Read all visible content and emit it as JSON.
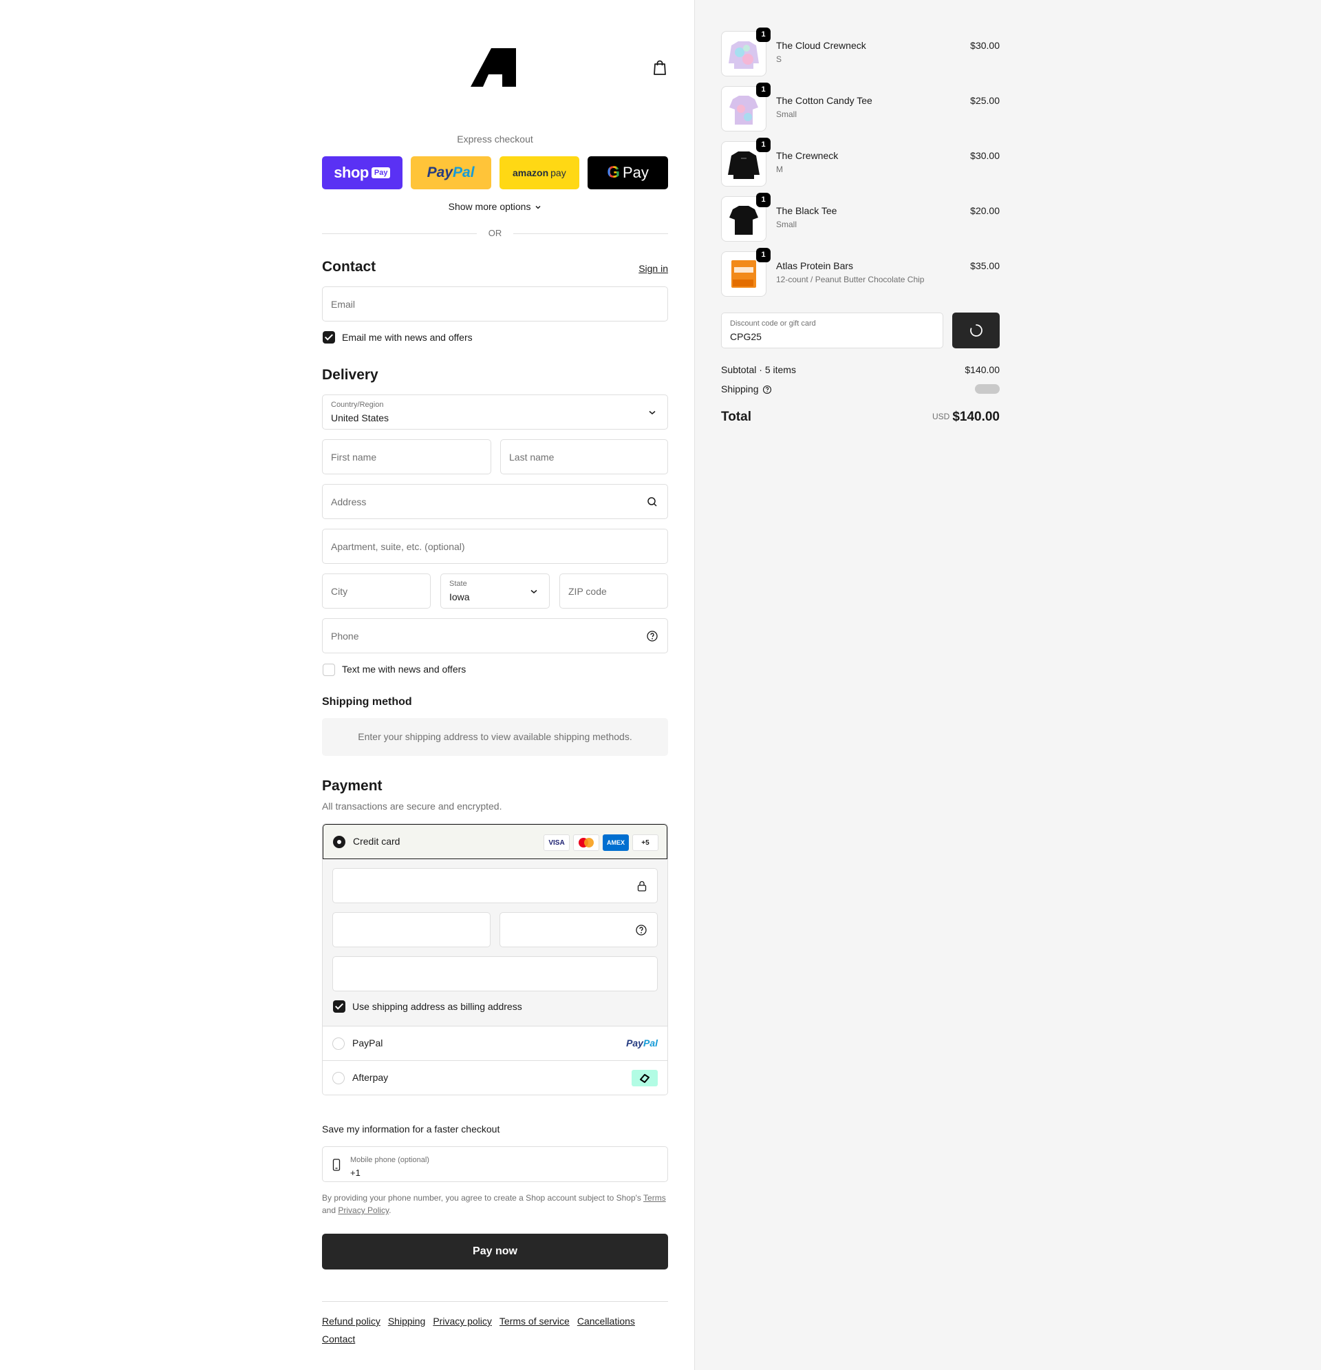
{
  "express": {
    "title": "Express checkout",
    "shoppay_word": "shop",
    "shoppay_pay": "Pay",
    "paypal_a": "Pay",
    "paypal_b": "Pal",
    "amazon_a": "amazon",
    "amazon_b": "pay",
    "gpay_g": "G",
    "gpay_pay": "Pay",
    "show_more": "Show more options",
    "or": "OR"
  },
  "contact": {
    "heading": "Contact",
    "sign_in": "Sign in",
    "email_placeholder": "Email",
    "news_label": "Email me with news and offers",
    "news_checked": true
  },
  "delivery": {
    "heading": "Delivery",
    "country_label": "Country/Region",
    "country_value": "United States",
    "first_name": "First name",
    "last_name": "Last name",
    "address": "Address",
    "apartment": "Apartment, suite, etc. (optional)",
    "city": "City",
    "state_label": "State",
    "state_value": "Iowa",
    "zip": "ZIP code",
    "phone": "Phone",
    "text_label": "Text me with news and offers",
    "text_checked": false
  },
  "shipping_method": {
    "heading": "Shipping method",
    "note": "Enter your shipping address to view available shipping methods."
  },
  "payment": {
    "heading": "Payment",
    "sub": "All transactions are secure and encrypted.",
    "credit_card": "Credit card",
    "card_logos": [
      "VISA",
      "MC",
      "AMEX",
      "+5"
    ],
    "billing_label": "Use shipping address as billing address",
    "paypal": "PayPal",
    "paypal_logo_a": "Pay",
    "paypal_logo_b": "Pal",
    "afterpay": "Afterpay"
  },
  "save": {
    "title": "Save my information for a faster checkout",
    "mobile_label": "Mobile phone (optional)",
    "mobile_value": "+1",
    "legal_a": "By providing your phone number, you agree to create a Shop account subject to Shop's ",
    "terms": "Terms",
    "legal_and": " and ",
    "privacy": "Privacy Policy",
    "legal_end": "."
  },
  "pay_now": "Pay now",
  "footer": [
    "Refund policy",
    "Shipping",
    "Privacy policy",
    "Terms of service",
    "Cancellations",
    "Contact"
  ],
  "order": {
    "items": [
      {
        "qty": "1",
        "name": "The Cloud Crewneck",
        "variant": "S",
        "price": "$30.00"
      },
      {
        "qty": "1",
        "name": "The Cotton Candy Tee",
        "variant": "Small",
        "price": "$25.00"
      },
      {
        "qty": "1",
        "name": "The Crewneck",
        "variant": "M",
        "price": "$30.00"
      },
      {
        "qty": "1",
        "name": "The Black Tee",
        "variant": "Small",
        "price": "$20.00"
      },
      {
        "qty": "1",
        "name": "Atlas Protein Bars",
        "variant": "12-count / Peanut Butter Chocolate Chip",
        "price": "$35.00"
      }
    ],
    "discount_label": "Discount code or gift card",
    "discount_value": "CPG25",
    "subtotal_label": "Subtotal · 5 items",
    "subtotal_value": "$140.00",
    "shipping_label": "Shipping",
    "total_label": "Total",
    "currency": "USD",
    "total_value": "$140.00"
  },
  "colors": {
    "shoppay": "#5a31f4",
    "paypal": "#ffc439",
    "amazon": "#ffd814",
    "dark_button": "#272727",
    "right_bg": "#f5f5f5"
  }
}
